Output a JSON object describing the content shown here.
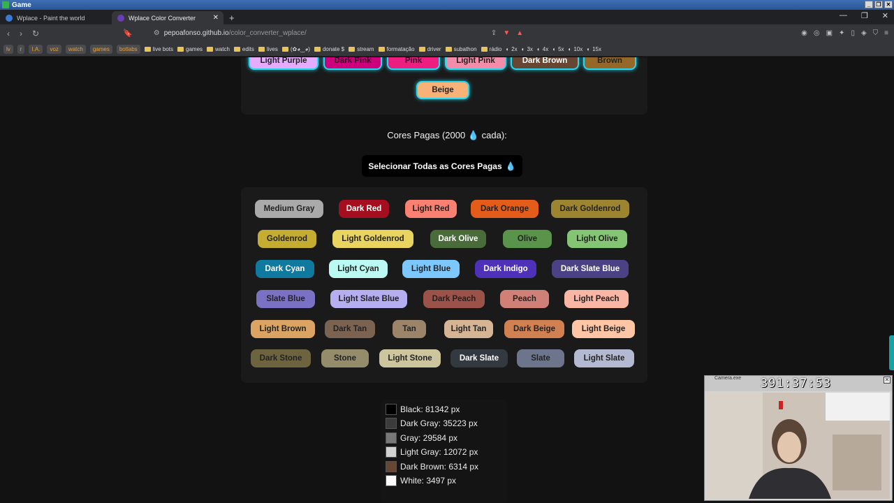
{
  "game_window": {
    "title": "Game"
  },
  "browser": {
    "tabs": [
      {
        "title": "Wplace - Paint the world",
        "active": false,
        "favicon_color": "#3a7bd5"
      },
      {
        "title": "Wplace Color Converter",
        "active": true,
        "favicon_color": "#6a3db8"
      }
    ],
    "new_tab_symbol": "+",
    "url_host": "pepoafonso.github.io",
    "url_path": "/color_converter_wplace/",
    "bookmarks": [
      {
        "label": "lv",
        "type": "pill"
      },
      {
        "label": "r",
        "type": "pill"
      },
      {
        "label": "I.A.",
        "type": "pill"
      },
      {
        "label": "voz",
        "type": "pill"
      },
      {
        "label": "watch",
        "type": "pill"
      },
      {
        "label": "games",
        "type": "pill"
      },
      {
        "label": "botlabs",
        "type": "pill"
      },
      {
        "label": "live bots",
        "type": "folder"
      },
      {
        "label": "games",
        "type": "folder"
      },
      {
        "label": "watch",
        "type": "folder"
      },
      {
        "label": "edits",
        "type": "folder"
      },
      {
        "label": "lives",
        "type": "folder"
      },
      {
        "label": "(✿◕‿◕)",
        "type": "folder"
      },
      {
        "label": "donate $",
        "type": "folder"
      },
      {
        "label": "stream",
        "type": "folder"
      },
      {
        "label": "formatação",
        "type": "folder"
      },
      {
        "label": "driver",
        "type": "folder"
      },
      {
        "label": "subathon",
        "type": "folder"
      },
      {
        "label": "rádio",
        "type": "folder"
      },
      {
        "label": "2x",
        "type": "link"
      },
      {
        "label": "3x",
        "type": "link"
      },
      {
        "label": "4x",
        "type": "link"
      },
      {
        "label": "5x",
        "type": "link"
      },
      {
        "label": "10x",
        "type": "link"
      },
      {
        "label": "15x",
        "type": "link"
      }
    ]
  },
  "free_colors_partial": [
    {
      "label": "Light Purple",
      "bg": "#e4abff",
      "fg": "#222222"
    },
    {
      "label": "Dark Pink",
      "bg": "#cb007a",
      "fg": "#3a0024"
    },
    {
      "label": "Pink",
      "bg": "#ec1f80",
      "fg": "#3a0024"
    },
    {
      "label": "Light Pink",
      "bg": "#f38da9",
      "fg": "#222222"
    },
    {
      "label": "Dark Brown",
      "bg": "#684634",
      "fg": "#ffffff"
    },
    {
      "label": "Brown",
      "bg": "#95682a",
      "fg": "#222222"
    },
    {
      "label": "Beige",
      "bg": "#f8b277",
      "fg": "#222222"
    }
  ],
  "paid_heading": {
    "text": "Cores Pagas (2000",
    "suffix": "cada):",
    "drop_icon": "💧"
  },
  "select_all_button": {
    "label": "Selecionar Todas as Cores Pagas",
    "drop_icon": "💧"
  },
  "paid_colors": [
    [
      {
        "label": "Medium Gray",
        "bg": "#aaaaaa",
        "fg": "#222222"
      },
      {
        "label": "Dark Red",
        "bg": "#a50e1e",
        "fg": "#ffffff"
      },
      {
        "label": "Light Red",
        "bg": "#fa8072",
        "fg": "#222222"
      },
      {
        "label": "Dark Orange",
        "bg": "#e45c1a",
        "fg": "#222222"
      },
      {
        "label": "Dark Goldenrod",
        "bg": "#9c8431",
        "fg": "#222222"
      }
    ],
    [
      {
        "label": "Goldenrod",
        "bg": "#c5ad31",
        "fg": "#222222"
      },
      {
        "label": "Light Goldenrod",
        "bg": "#e8d45f",
        "fg": "#222222"
      },
      {
        "label": "Dark Olive",
        "bg": "#4a6b3a",
        "fg": "#ffffff"
      },
      {
        "label": "Olive",
        "bg": "#5a944a",
        "fg": "#222222"
      },
      {
        "label": "Light Olive",
        "bg": "#84c573",
        "fg": "#222222"
      }
    ],
    [
      {
        "label": "Dark Cyan",
        "bg": "#0f799f",
        "fg": "#ffffff"
      },
      {
        "label": "Light Cyan",
        "bg": "#bbfaf2",
        "fg": "#222222"
      },
      {
        "label": "Light Blue",
        "bg": "#7dc7ff",
        "fg": "#222222"
      },
      {
        "label": "Dark Indigo",
        "bg": "#4d31b8",
        "fg": "#ffffff"
      },
      {
        "label": "Dark Slate Blue",
        "bg": "#4a4284",
        "fg": "#ffffff"
      }
    ],
    [
      {
        "label": "Slate Blue",
        "bg": "#7a71c4",
        "fg": "#222222"
      },
      {
        "label": "Light Slate Blue",
        "bg": "#b5aef1",
        "fg": "#222222"
      },
      {
        "label": "Dark Peach",
        "bg": "#9b5249",
        "fg": "#222222"
      },
      {
        "label": "Peach",
        "bg": "#d18078",
        "fg": "#222222"
      },
      {
        "label": "Light Peach",
        "bg": "#fab6a4",
        "fg": "#222222"
      }
    ],
    [
      {
        "label": "Light Brown",
        "bg": "#dba463",
        "fg": "#222222"
      },
      {
        "label": "Dark Tan",
        "bg": "#7b6352",
        "fg": "#222222"
      },
      {
        "label": "Tan",
        "bg": "#9c846b",
        "fg": "#222222"
      },
      {
        "label": "Light Tan",
        "bg": "#d6b594",
        "fg": "#222222"
      },
      {
        "label": "Dark Beige",
        "bg": "#d18051",
        "fg": "#222222"
      },
      {
        "label": "Light Beige",
        "bg": "#ffc5a5",
        "fg": "#222222"
      }
    ],
    [
      {
        "label": "Dark Stone",
        "bg": "#6d643f",
        "fg": "#222222"
      },
      {
        "label": "Stone",
        "bg": "#948c6b",
        "fg": "#222222"
      },
      {
        "label": "Light Stone",
        "bg": "#cdc59e",
        "fg": "#222222"
      },
      {
        "label": "Dark Slate",
        "bg": "#333941",
        "fg": "#ffffff"
      },
      {
        "label": "Slate",
        "bg": "#6d758d",
        "fg": "#222222"
      },
      {
        "label": "Light Slate",
        "bg": "#b3b9d1",
        "fg": "#222222"
      }
    ]
  ],
  "pixel_counts": [
    {
      "label": "Black: 81342 px",
      "swatch": "#000000"
    },
    {
      "label": "Dark Gray: 35223 px",
      "swatch": "#3c3c3c"
    },
    {
      "label": "Gray: 29584 px",
      "swatch": "#787878"
    },
    {
      "label": "Light Gray: 12072 px",
      "swatch": "#d2d2d2"
    },
    {
      "label": "Dark Brown: 6314 px",
      "swatch": "#684634"
    },
    {
      "label": "White: 3497 px",
      "swatch": "#ffffff"
    }
  ],
  "camera": {
    "title": "Camera.exe",
    "timer": "391:37:53"
  }
}
